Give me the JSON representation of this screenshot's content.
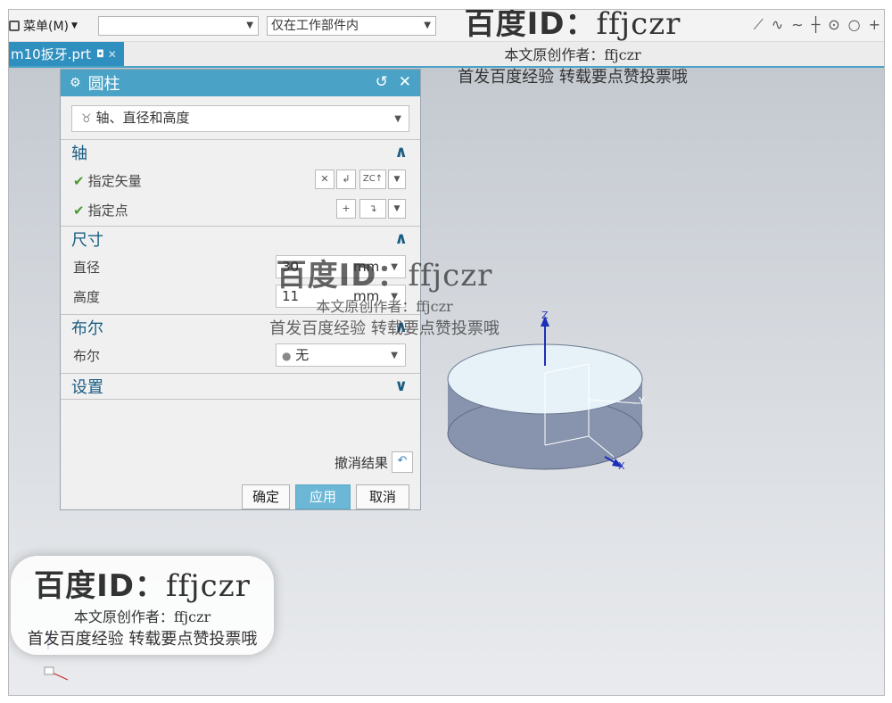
{
  "toolbar": {
    "menu_label": "菜单(M)",
    "filter_value": "",
    "scope_value": "仅在工作部件内"
  },
  "tab": {
    "label": "m10扳牙.prt"
  },
  "dialog": {
    "title": "圆柱",
    "type_value": "轴、直径和高度",
    "axis": {
      "header": "轴",
      "vector_label": "指定矢量",
      "point_label": "指定点",
      "zc_label": "ZC"
    },
    "dimensions": {
      "header": "尺寸",
      "diameter_label": "直径",
      "diameter_value": "30",
      "diameter_unit": "mm",
      "height_label": "高度",
      "height_value": "11",
      "height_unit": "mm"
    },
    "boolean": {
      "header": "布尔",
      "label": "布尔",
      "value": "无"
    },
    "settings": {
      "header": "设置"
    },
    "undo_label": "撤消结果",
    "ok_label": "确定",
    "apply_label": "应用",
    "cancel_label": "取消"
  },
  "viewport": {
    "axis_z": "Z",
    "axis_y": "Y",
    "axis_x": "X"
  },
  "watermark": {
    "id_prefix": "百度ID：",
    "id_name": "ffjczr",
    "author_line": "本文原创作者：ffjczr",
    "slogan": "首发百度经验 转载要点赞投票哦"
  },
  "colors": {
    "accent": "#4aa3c6",
    "tab_active": "#2f8fbf",
    "cylinder_side": "#8893ad",
    "cylinder_top": "#e6f2f8"
  }
}
